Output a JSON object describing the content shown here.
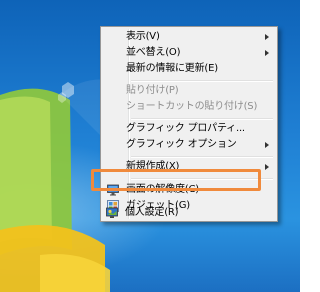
{
  "context_menu": {
    "items": [
      {
        "label": "表示(V)",
        "submenu": true,
        "disabled": false
      },
      {
        "label": "並べ替え(O)",
        "submenu": true,
        "disabled": false
      },
      {
        "label": "最新の情報に更新(E)",
        "submenu": false,
        "disabled": false
      },
      {
        "label": "貼り付け(P)",
        "submenu": false,
        "disabled": true
      },
      {
        "label": "ショートカットの貼り付け(S)",
        "submenu": false,
        "disabled": true
      },
      {
        "label": "グラフィック プロパティ...",
        "submenu": false,
        "disabled": false
      },
      {
        "label": "グラフィック オプション",
        "submenu": true,
        "disabled": false
      },
      {
        "label": "新規作成(X)",
        "submenu": true,
        "disabled": false
      },
      {
        "label": "画面の解像度(C)",
        "submenu": false,
        "disabled": false,
        "icon": "display-icon",
        "highlighted": true
      },
      {
        "label": "ガジェット(G)",
        "submenu": false,
        "disabled": false,
        "icon": "gadget-icon"
      },
      {
        "label": "個人設定(R)",
        "submenu": false,
        "disabled": false,
        "icon": "personalize-icon"
      }
    ]
  },
  "colors": {
    "highlight_border": "#f08a3c",
    "menu_background": "#f0f0f0",
    "desktop_blue": "#1f7fd3"
  }
}
